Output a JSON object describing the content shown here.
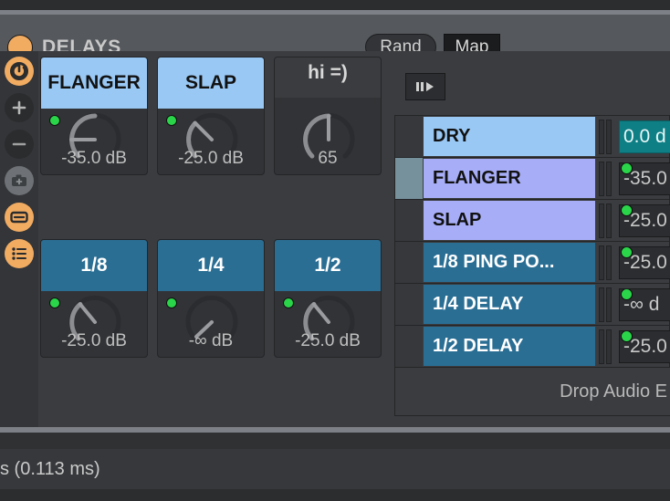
{
  "device": {
    "title": "DELAYS",
    "power_icon": "power-dot-icon",
    "rand_label": "Rand",
    "map_label": "Map"
  },
  "rail": {
    "items": [
      {
        "name": "macro-variations-icon"
      },
      {
        "name": "add-macro-icon"
      },
      {
        "name": "remove-macro-icon"
      },
      {
        "name": "snapshot-camera-icon"
      },
      {
        "name": "show-macros-icon"
      },
      {
        "name": "chain-list-icon"
      }
    ]
  },
  "macro_grid": {
    "cells": [
      {
        "label": "FLANGER",
        "color": "lightblue",
        "value": "-35.0 dB",
        "led": true,
        "angle": -90
      },
      {
        "label": "SLAP",
        "color": "lightblue",
        "value": "-25.0 dB",
        "led": true,
        "angle": -45
      },
      {
        "label": "hi =)",
        "color": "none",
        "value": "65",
        "led": false,
        "angle": 0
      },
      {
        "label": "1/8",
        "color": "teal",
        "value": "-25.0 dB",
        "led": true,
        "angle": -38
      },
      {
        "label": "1/4",
        "color": "teal",
        "value": "-∞ dB",
        "led": true,
        "angle": -140
      },
      {
        "label": "1/2",
        "color": "teal",
        "value": "-25.0 dB",
        "led": true,
        "angle": -38
      }
    ]
  },
  "right_panel": {
    "auto_select_icon": "play-pause-icon",
    "rows": [
      {
        "name": "DRY",
        "color": "c-lightblue",
        "value": "0.0 d",
        "selected": false,
        "value_active": true,
        "led": false
      },
      {
        "name": "FLANGER",
        "color": "c-periwinkle",
        "value": "-35.0",
        "selected": true,
        "value_active": false,
        "led": true
      },
      {
        "name": "SLAP",
        "color": "c-periwinkle",
        "value": "-25.0",
        "selected": false,
        "value_active": false,
        "led": true
      },
      {
        "name": "1/8 PING PO...",
        "color": "c-teal",
        "value": "-25.0",
        "selected": false,
        "value_active": false,
        "led": true
      },
      {
        "name": "1/4 DELAY",
        "color": "c-teal",
        "value": "-∞ d",
        "selected": false,
        "value_active": false,
        "led": true
      },
      {
        "name": "1/2 DELAY",
        "color": "c-teal",
        "value": "-25.0",
        "selected": false,
        "value_active": false,
        "led": true
      }
    ],
    "drop_zone_label": "Drop Audio E"
  },
  "status_bar": {
    "text": "s (0.113 ms)"
  },
  "colors": {
    "accent_orange": "#f2ac62",
    "chain_lightblue": "#99c8f4",
    "chain_periwinkle": "#a7aef7",
    "chain_teal": "#2a6e94",
    "led_green": "#2ad54a",
    "value_active_teal": "#0e7f85"
  }
}
